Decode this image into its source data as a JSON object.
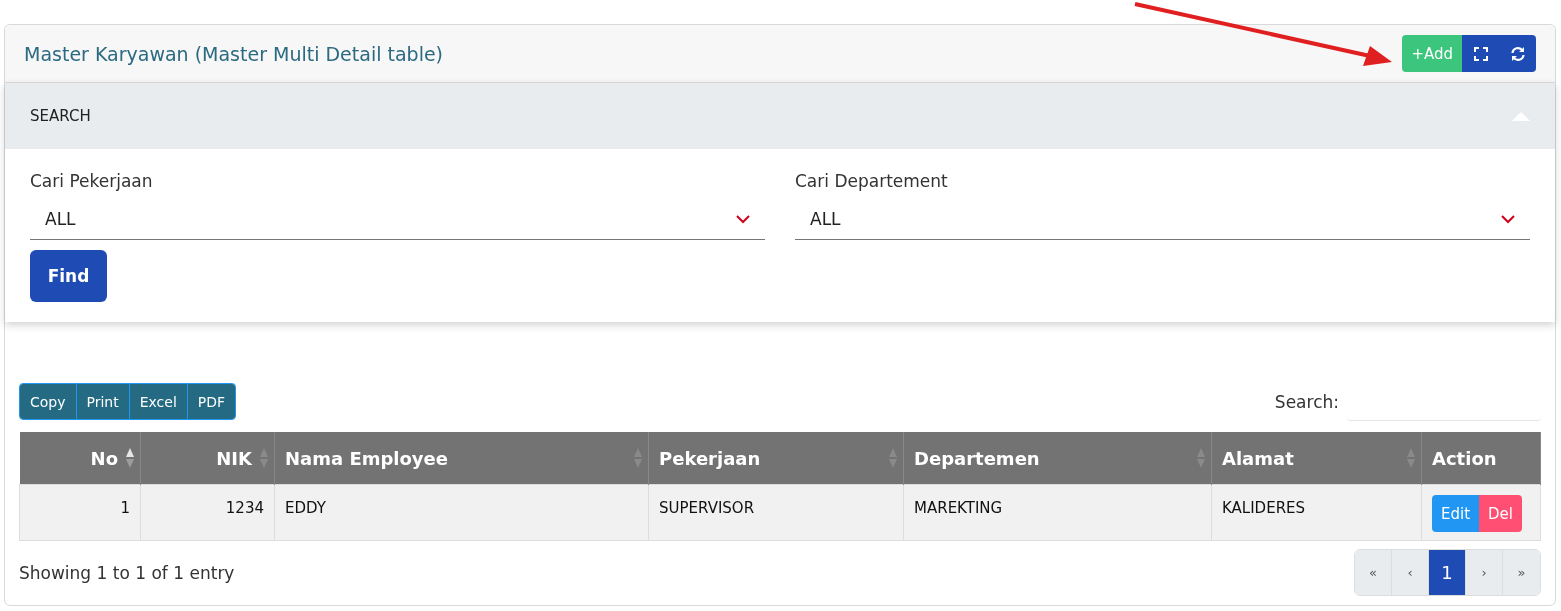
{
  "card": {
    "title": "Master Karyawan (Master Multi Detail table)",
    "add_label": "+Add"
  },
  "search_panel": {
    "title": "SEARCH",
    "expanded": true,
    "fields": [
      {
        "label": "Cari Pekerjaan",
        "value": "ALL"
      },
      {
        "label": "Cari Departement",
        "value": "ALL"
      }
    ],
    "find_label": "Find"
  },
  "export_buttons": [
    "Copy",
    "Print",
    "Excel",
    "PDF"
  ],
  "table_search": {
    "label": "Search:"
  },
  "table": {
    "columns": [
      {
        "label": "No",
        "right_aligned": true,
        "sortable": true,
        "sorted_ascending": true
      },
      {
        "label": "NIK",
        "right_aligned": true,
        "sortable": true,
        "sorted_ascending": false
      },
      {
        "label": "Nama Employee",
        "right_aligned": false,
        "sortable": true,
        "sorted_ascending": false
      },
      {
        "label": "Pekerjaan",
        "right_aligned": false,
        "sortable": true,
        "sorted_ascending": false
      },
      {
        "label": "Departemen",
        "right_aligned": false,
        "sortable": true,
        "sorted_ascending": false
      },
      {
        "label": "Alamat",
        "right_aligned": false,
        "sortable": true,
        "sorted_ascending": false
      },
      {
        "label": "Action",
        "right_aligned": false,
        "sortable": false
      }
    ],
    "rows": [
      {
        "cells": [
          "1",
          "1234",
          "EDDY",
          "SUPERVISOR",
          "MAREKTING",
          "KALIDERES"
        ],
        "actions": [
          {
            "label": "Edit",
            "kind": "edit"
          },
          {
            "label": "Del",
            "kind": "delete"
          }
        ]
      }
    ]
  },
  "info": "Showing 1 to 1 of 1 entry",
  "pagination": [
    {
      "label": "«",
      "selected": false
    },
    {
      "label": "‹",
      "selected": false
    },
    {
      "label": "1",
      "selected": true
    },
    {
      "label": "›",
      "selected": false
    },
    {
      "label": "»",
      "selected": false
    }
  ]
}
